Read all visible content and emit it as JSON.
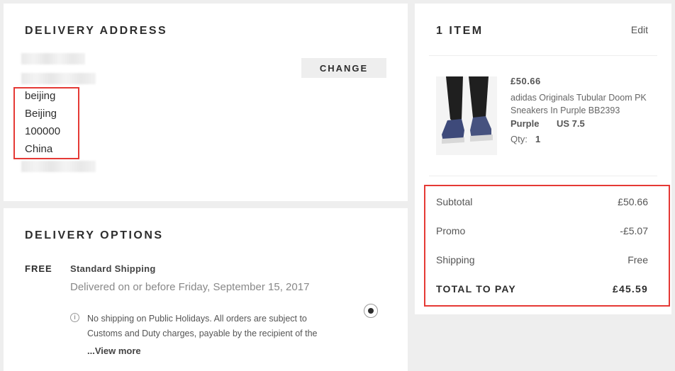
{
  "delivery_address": {
    "heading": "DELIVERY ADDRESS",
    "change_label": "CHANGE",
    "city": "beijing",
    "region": "Beijing",
    "postcode": "100000",
    "country": "China"
  },
  "delivery_options": {
    "heading": "DELIVERY OPTIONS",
    "price_tag": "FREE",
    "method_name": "Standard Shipping",
    "eta": "Delivered on or before Friday, September 15, 2017",
    "note": "No shipping on Public Holidays. All orders are subject to Customs and Duty charges, payable by the recipient of the",
    "view_more": "...View more",
    "selected": true
  },
  "cart": {
    "heading": "1 ITEM",
    "edit_label": "Edit",
    "item": {
      "price": "£50.66",
      "name": "adidas Originals Tubular Doom PK Sneakers In Purple BB2393",
      "color": "Purple",
      "size": "US 7.5",
      "qty_label": "Qty:",
      "qty": "1"
    },
    "summary": {
      "subtotal_label": "Subtotal",
      "subtotal": "£50.66",
      "promo_label": "Promo",
      "promo": "-£5.07",
      "shipping_label": "Shipping",
      "shipping": "Free",
      "total_label": "TOTAL TO PAY",
      "total": "£45.59"
    }
  },
  "colors": {
    "highlight_box": "#e53935",
    "page_background": "#eeeeee",
    "panel_background": "#ffffff"
  }
}
